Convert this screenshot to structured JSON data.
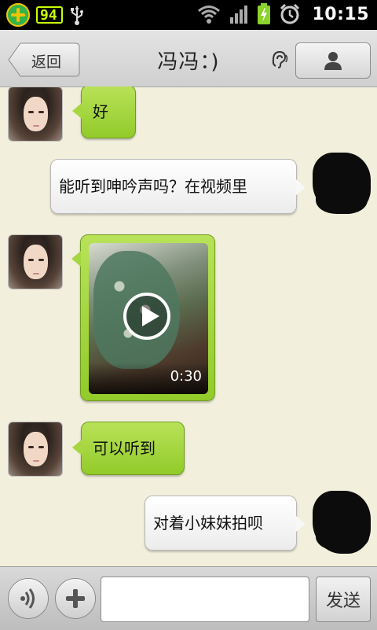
{
  "status_bar": {
    "battery_level": "94",
    "time": "10:15",
    "icons": [
      "app-plus-icon",
      "usb-icon",
      "wifi-icon",
      "signal-icon",
      "battery-charging-icon",
      "alarm-icon"
    ]
  },
  "header": {
    "back_label": "返回",
    "title": "冯冯：)",
    "icons": [
      "ear-icon",
      "profile-icon"
    ]
  },
  "messages": [
    {
      "side": "left",
      "type": "text",
      "text": "好"
    },
    {
      "side": "right",
      "type": "text",
      "text": "能听到呻吟声吗？在视频里"
    },
    {
      "side": "left",
      "type": "video",
      "duration": "0:30"
    },
    {
      "side": "left",
      "type": "text",
      "text": "可以听到"
    },
    {
      "side": "right",
      "type": "text",
      "text": "对着小妹妹拍呗"
    }
  ],
  "input_bar": {
    "input_value": "",
    "send_label": "发送",
    "icons": [
      "voice-icon",
      "plus-icon"
    ]
  },
  "colors": {
    "chat_background": "#f2efdc",
    "bubble_green": "#a6d641",
    "bubble_white": "#ffffff"
  }
}
